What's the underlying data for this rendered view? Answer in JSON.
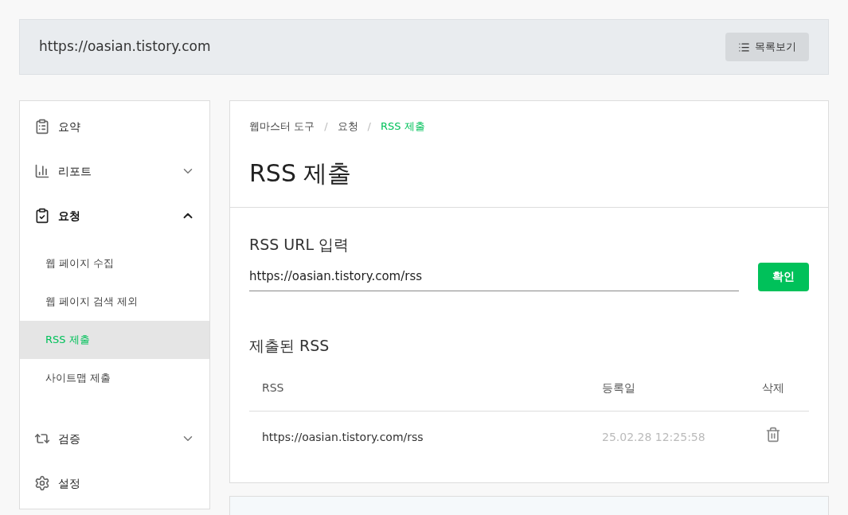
{
  "header": {
    "site_url": "https://oasian.tistory.com",
    "list_button": "목록보기"
  },
  "sidebar": {
    "items": [
      {
        "label": "요약",
        "kind": "link"
      },
      {
        "label": "리포트",
        "kind": "group",
        "expanded": false
      },
      {
        "label": "요청",
        "kind": "group",
        "expanded": true,
        "children": [
          {
            "label": "웹 페이지 수집",
            "selected": false
          },
          {
            "label": "웹 페이지 검색 제외",
            "selected": false
          },
          {
            "label": "RSS 제출",
            "selected": true
          },
          {
            "label": "사이트맵 제출",
            "selected": false
          }
        ]
      },
      {
        "label": "검증",
        "kind": "group",
        "expanded": false
      },
      {
        "label": "설정",
        "kind": "link"
      }
    ]
  },
  "breadcrumb": [
    {
      "label": "웹마스터 도구",
      "current": false
    },
    {
      "label": "요청",
      "current": false
    },
    {
      "label": "RSS 제출",
      "current": true
    }
  ],
  "separator": "/",
  "title": "RSS 제출",
  "url_section": {
    "label": "RSS URL 입력",
    "value": "https://oasian.tistory.com/rss",
    "button": "확인"
  },
  "submitted": {
    "title": "제출된 RSS",
    "columns": [
      "RSS",
      "등록일",
      "삭제"
    ],
    "rows": [
      {
        "rss": "https://oasian.tistory.com/rss",
        "date": "25.02.28 12:25:58"
      }
    ]
  }
}
